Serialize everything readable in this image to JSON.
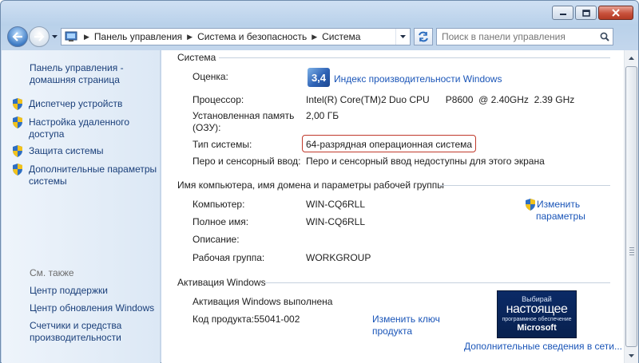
{
  "breadcrumb": [
    "Панель управления",
    "Система и безопасность",
    "Система"
  ],
  "search": {
    "placeholder": "Поиск в панели управления"
  },
  "sidebar": {
    "home_line1": "Панель управления -",
    "home_line2": "домашняя страница",
    "items": [
      {
        "lines": [
          "Диспетчер устройств"
        ]
      },
      {
        "lines": [
          "Настройка удаленного",
          "доступа"
        ]
      },
      {
        "lines": [
          "Защита системы"
        ]
      },
      {
        "lines": [
          "Дополнительные параметры",
          "системы"
        ]
      }
    ],
    "see_also": "См. также",
    "see_also_items": [
      {
        "lines": [
          "Центр поддержки"
        ]
      },
      {
        "lines": [
          "Центр обновления Windows"
        ]
      },
      {
        "lines": [
          "Счетчики и средства",
          "производительности"
        ]
      }
    ]
  },
  "system": {
    "title": "Система",
    "rating_label": "Оценка:",
    "rating_score": "3,4",
    "rating_link": "Индекс производительности Windows",
    "processor_label": "Процессор:",
    "processor_value": "Intel(R) Core(TM)2 Duo CPU      P8600  @ 2.40GHz  2.39 GHz",
    "memory_label_1": "Установленная память",
    "memory_label_2": "(ОЗУ):",
    "memory_value": "2,00 ГБ",
    "type_label": "Тип системы:",
    "type_value": "64-разрядная операционная система",
    "pen_label": "Перо и сенсорный ввод:",
    "pen_value": "Перо и сенсорный ввод недоступны для этого экрана"
  },
  "computer": {
    "title": "Имя компьютера, имя домена и параметры рабочей группы",
    "name_label": "Компьютер:",
    "name_value": "WIN-CQ6RLL",
    "full_label": "Полное имя:",
    "full_value": "WIN-CQ6RLL",
    "desc_label": "Описание:",
    "group_label": "Рабочая группа:",
    "group_value": "WORKGROUP",
    "change_link_1": "Изменить",
    "change_link_2": "параметры"
  },
  "activation": {
    "title": "Активация Windows",
    "status": "Активация Windows выполнена",
    "key_label": "Код продукта:",
    "key_value": "55041-002",
    "change_key_1": "Изменить ключ",
    "change_key_2": "продукта",
    "genuine_1": "Выбирай",
    "genuine_2": "настоящее",
    "genuine_3": "программное обеспечение",
    "genuine_4": "Microsoft",
    "more_link": "Дополнительные сведения в сети..."
  },
  "colors": {
    "link": "#1a55b8",
    "highlight": "#c0392b",
    "sidebar_link": "#1a3f7a"
  }
}
